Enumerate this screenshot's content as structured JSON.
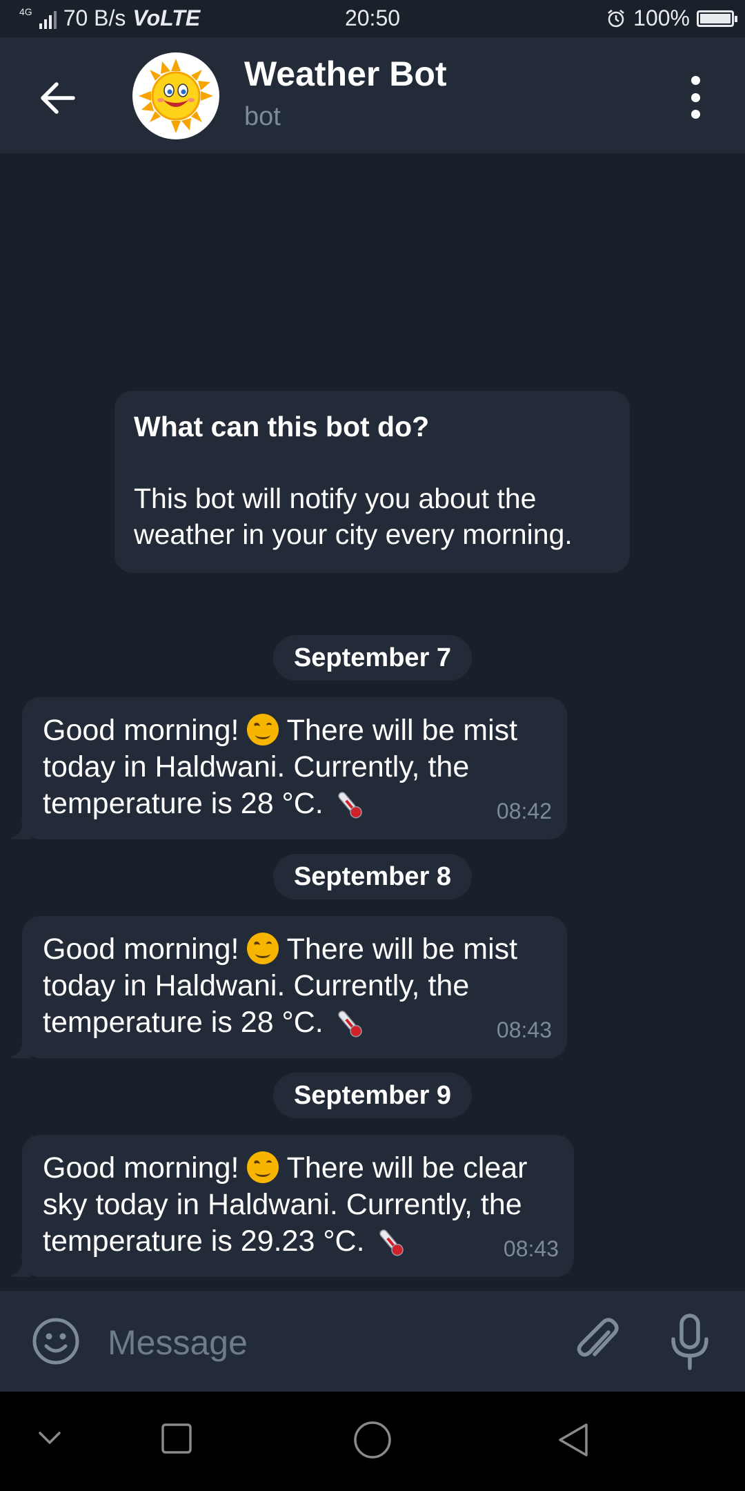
{
  "status_bar": {
    "network_type": "4G",
    "speed": "70 B/s",
    "volte": "VoLTE",
    "time": "20:50",
    "battery": "100%",
    "battery_level": 1.0,
    "icons": [
      "signal-icon",
      "alarm-icon",
      "battery-icon"
    ]
  },
  "header": {
    "back_icon": "arrow-left-icon",
    "avatar_icon": "smiling-sun-icon",
    "title": "Weather Bot",
    "subtitle": "bot",
    "menu_icon": "more-vertical-icon"
  },
  "info_card": {
    "question": "What can this bot do?",
    "description": "This bot will notify you about the weather in your city every morning."
  },
  "messages": [
    {
      "date": "September 7",
      "text_before": "Good morning!",
      "text_after": "There will be mist today in Haldwani. Currently, the temperature is 28 °C.",
      "time": "08:42"
    },
    {
      "date": "September 8",
      "text_before": "Good morning!",
      "text_after": "There will be mist today in Haldwani. Currently, the temperature is 28 °C.",
      "time": "08:43"
    },
    {
      "date": "September 9",
      "text_before": "Good morning!",
      "text_after": "There will be clear sky today in Haldwani. Currently, the temperature is 29.23 °C.",
      "time": "08:43"
    }
  ],
  "input_bar": {
    "placeholder": "Message",
    "icons": [
      "emoji-icon",
      "paperclip-icon",
      "microphone-icon"
    ]
  },
  "nav_bar": {
    "icons": [
      "chevron-down-icon",
      "square-recents-icon",
      "circle-home-icon",
      "triangle-back-icon"
    ]
  },
  "colors": {
    "background": "#18202a",
    "surface": "#222b37",
    "secondary_text": "#7d8b99",
    "primary_text": "#ffffff"
  }
}
